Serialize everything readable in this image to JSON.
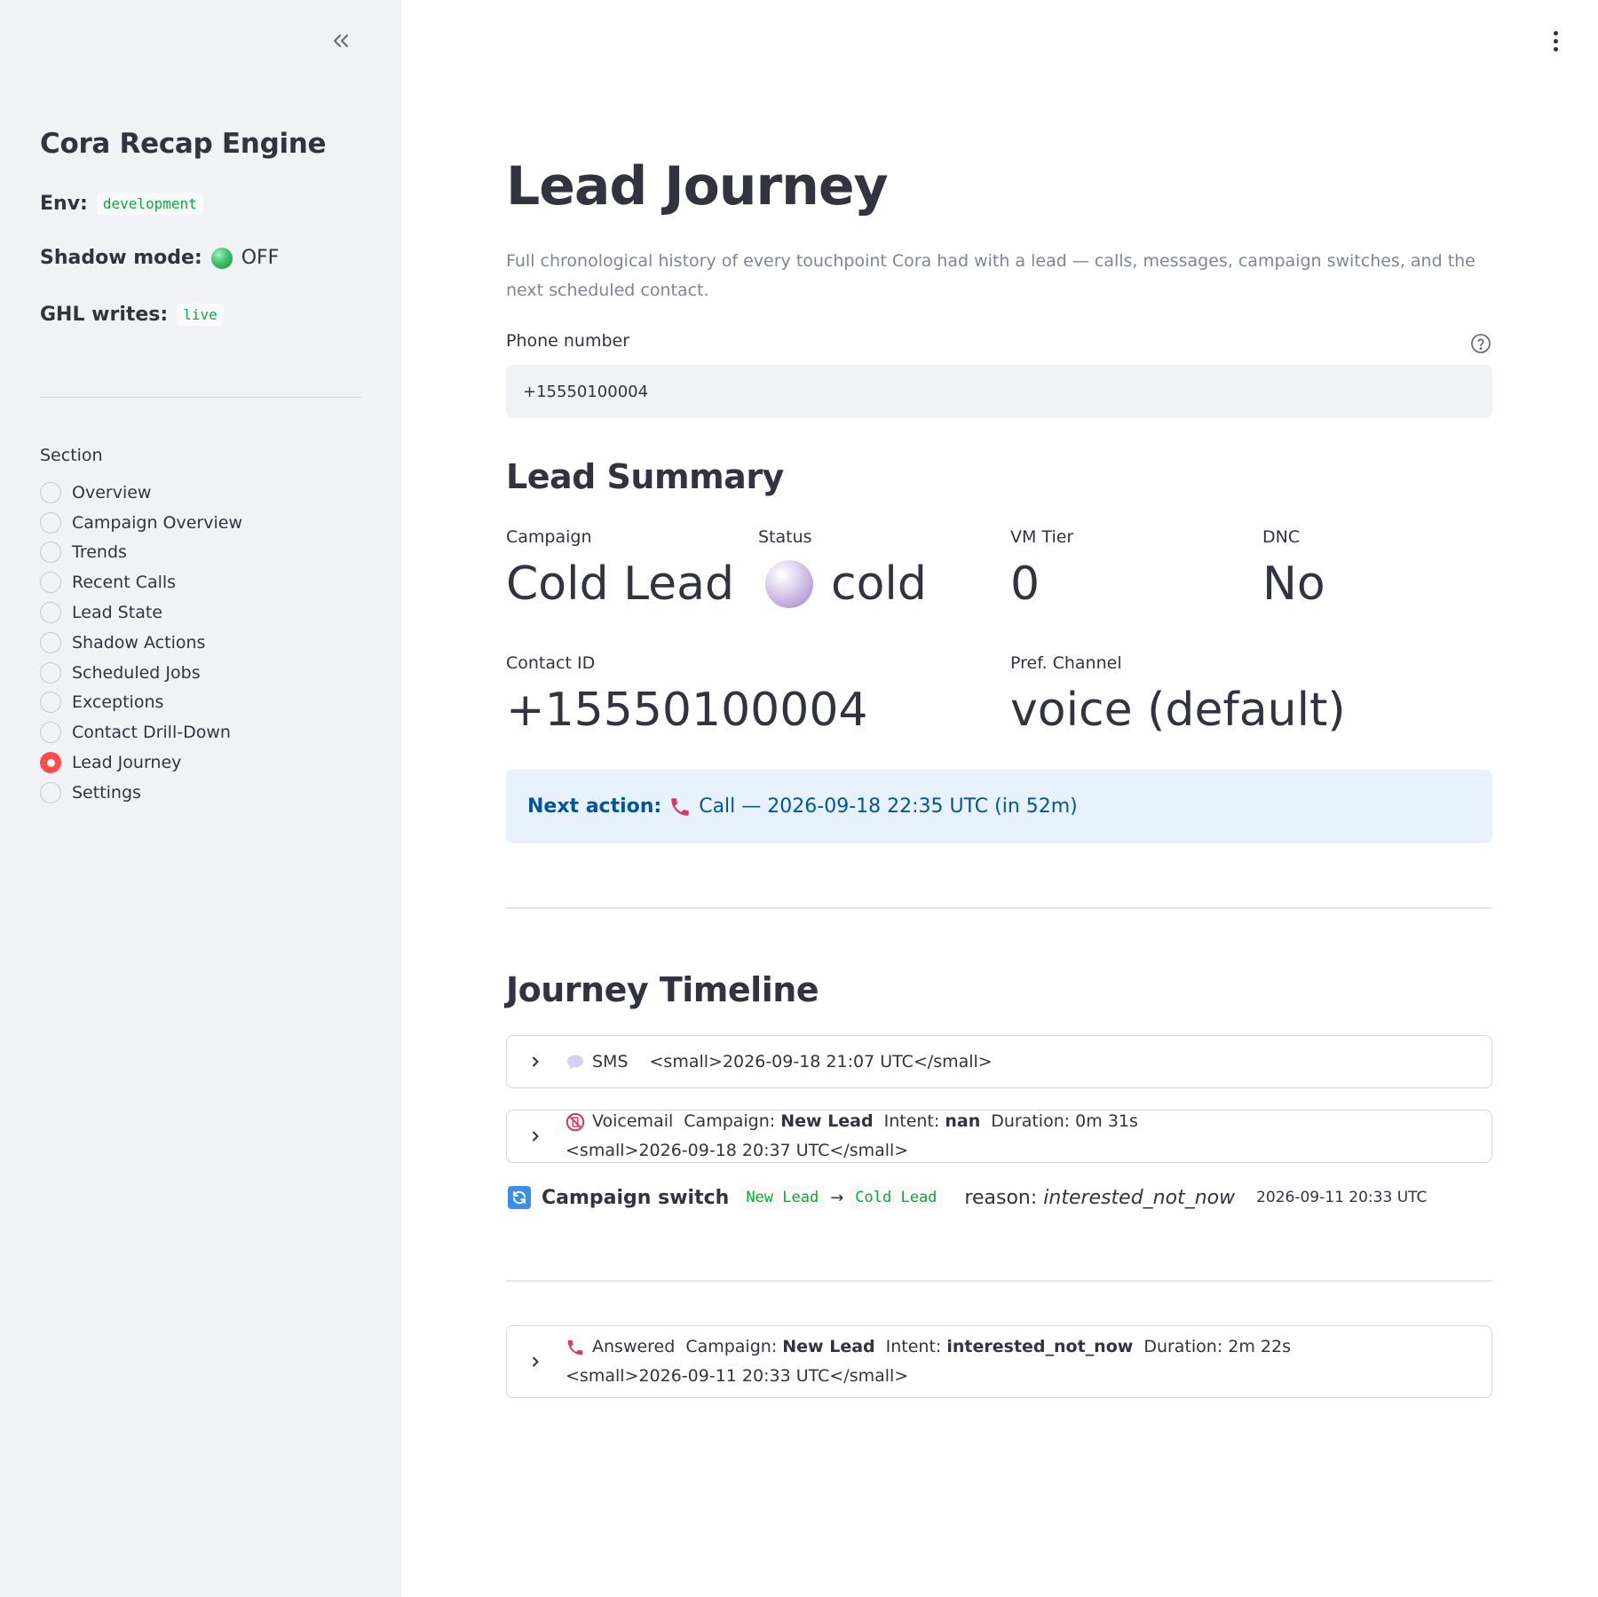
{
  "sidebar": {
    "app_title": "Cora Recap Engine",
    "env_label": "Env:",
    "env_value": "development",
    "shadow_label": "Shadow mode:",
    "shadow_value": "OFF",
    "ghl_label": "GHL writes:",
    "ghl_value": "live",
    "section_label": "Section",
    "items": [
      {
        "label": "Overview",
        "selected": false
      },
      {
        "label": "Campaign Overview",
        "selected": false
      },
      {
        "label": "Trends",
        "selected": false
      },
      {
        "label": "Recent Calls",
        "selected": false
      },
      {
        "label": "Lead State",
        "selected": false
      },
      {
        "label": "Shadow Actions",
        "selected": false
      },
      {
        "label": "Scheduled Jobs",
        "selected": false
      },
      {
        "label": "Exceptions",
        "selected": false
      },
      {
        "label": "Contact Drill-Down",
        "selected": false
      },
      {
        "label": "Lead Journey",
        "selected": true
      },
      {
        "label": "Settings",
        "selected": false
      }
    ]
  },
  "main": {
    "title": "Lead Journey",
    "description": "Full chronological history of every touchpoint Cora had with a lead — calls, messages, campaign switches, and the next scheduled contact.",
    "phone": {
      "label": "Phone number",
      "value": "+15550100004"
    },
    "summary": {
      "heading": "Lead Summary",
      "campaign_label": "Campaign",
      "campaign_value": "Cold Lead",
      "status_label": "Status",
      "status_value": "cold",
      "vm_label": "VM Tier",
      "vm_value": "0",
      "dnc_label": "DNC",
      "dnc_value": "No",
      "contact_label": "Contact ID",
      "contact_value": "+15550100004",
      "channel_label": "Pref. Channel",
      "channel_value": "voice (default)"
    },
    "next_action": {
      "label": "Next action:",
      "text": "Call — 2026-09-18 22:35 UTC (in 52m)"
    },
    "timeline": {
      "heading": "Journey Timeline",
      "sms": {
        "type": "SMS",
        "timestamp": "<small>2026-09-18 21:07 UTC</small>"
      },
      "voicemail": {
        "type": "Voicemail",
        "campaign_label": "Campaign:",
        "campaign": "New Lead",
        "intent_label": "Intent:",
        "intent": "nan",
        "duration": "Duration: 0m 31s",
        "timestamp": "<small>2026-09-18 20:37 UTC</small>"
      },
      "switch": {
        "label": "Campaign switch",
        "from": "New Lead",
        "arrow": "→",
        "to": "Cold Lead",
        "reason_label": "reason:",
        "reason": "interested_not_now",
        "timestamp": "2026-09-11 20:33 UTC"
      },
      "answered": {
        "type": "Answered",
        "campaign_label": "Campaign:",
        "campaign": "New Lead",
        "intent_label": "Intent:",
        "intent": "interested_not_now",
        "duration": "Duration: 2m 22s",
        "timestamp": "<small>2026-09-11 20:33 UTC</small>"
      }
    }
  },
  "colors": {
    "accent_red": "#ff4b4b",
    "info_bg": "#e8f2fd",
    "info_text": "#0054a3",
    "code_green": "#09ab3b"
  }
}
